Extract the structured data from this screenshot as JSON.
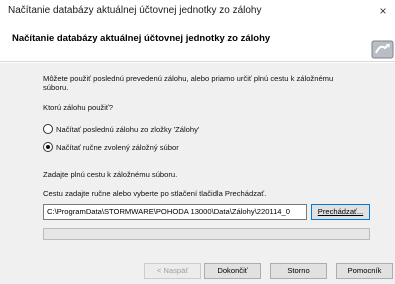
{
  "window": {
    "title": "Načítanie databázy aktuálnej účtovnej jednotky zo zálohy",
    "close_glyph": "×"
  },
  "header": {
    "title": "Načítanie databázy aktuálnej účtovnej jednotky zo zálohy",
    "icon": "database-restore-icon"
  },
  "intro": {
    "line1": "Môžete použiť poslednú prevedenú zálohu, alebo priamo určiť plnú cestu k záložnému",
    "line2": "súboru."
  },
  "question": "Ktorú zálohu použiť?",
  "options": [
    {
      "label": "Načítať poslednú zálohu zo zložky 'Zálohy'",
      "checked": false
    },
    {
      "label": "Načítať ručne zvolený záložný súbor",
      "checked": true
    }
  ],
  "path_section": {
    "heading": "Zadajte plnú cestu k záložnému súboru.",
    "hint": "Cestu zadajte ručne alebo vyberte po stlačení tlačidla Prechádzať.",
    "value": "C:\\ProgramData\\STORMWARE\\POHODA 13000\\Data\\Zálohy\\220114_0",
    "browse_label": "Prechádzať..."
  },
  "progress": {
    "value": 0
  },
  "buttons": {
    "back": "< Naspäť",
    "finish": "Dokončiť",
    "cancel": "Storno",
    "help": "Pomocník"
  },
  "colors": {
    "accent": "#0078d7",
    "panel": "#f0f0f0",
    "button": "#e1e1e1"
  }
}
